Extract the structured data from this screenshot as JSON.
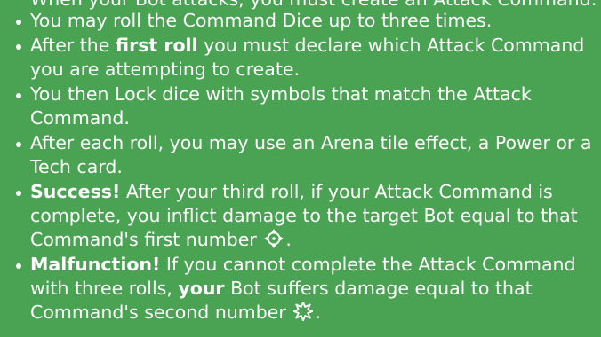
{
  "intro": "When your Bot attacks, you must create an Attack Command:",
  "rules": [
    {
      "text": "You may roll the Command Dice up to three times."
    },
    {
      "pre": "After the ",
      "bold": "first roll",
      "post": " you must declare which Attack Command you are attempting to create."
    },
    {
      "text": "You then Lock dice with symbols that match the Attack Command."
    },
    {
      "text": "After each roll, you may use an Arena tile effect, a Power or a Tech card."
    },
    {
      "bold": "Success!",
      "post": " After your third roll, if your Attack Command is complete, you inflict damage to the target Bot equal to that Command's first number",
      "icon": "crosshair-icon",
      "end": "."
    },
    {
      "bold": "Malfunction!",
      "mid": " If you cannot complete the Attack Command with three rolls, ",
      "bold2": "your",
      "post": " Bot suffers damage equal to that Command's second number",
      "icon": "burst-icon",
      "end": "."
    }
  ]
}
